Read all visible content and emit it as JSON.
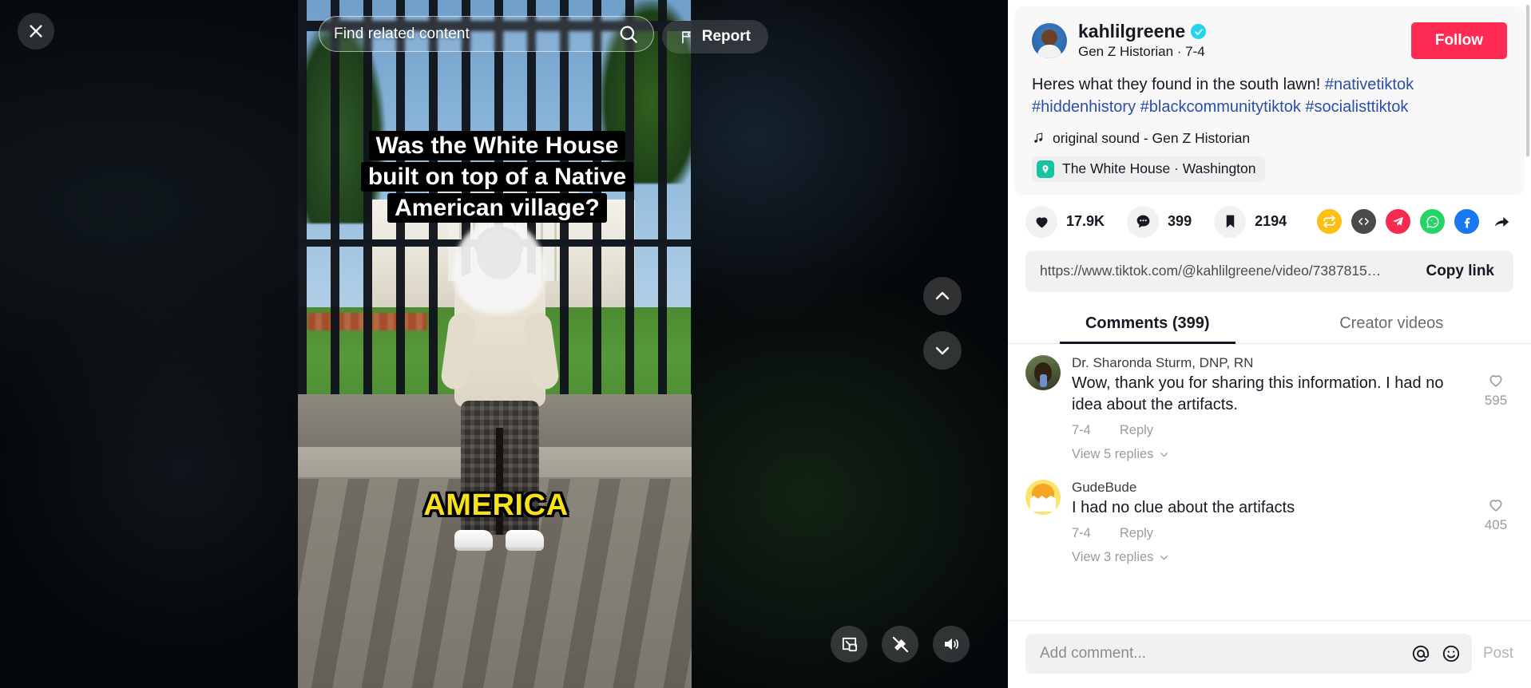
{
  "video": {
    "search_placeholder": "Find related content",
    "search_icon": "search-icon",
    "overlay_caption": "Was the White House built on top of a Native American village?",
    "overlay_word": "AMERICA",
    "close_icon": "close-icon",
    "report_label": "Report",
    "report_icon": "flag-icon",
    "nav_up_icon": "chevron-up-icon",
    "nav_down_icon": "chevron-down-icon",
    "controls": [
      {
        "name": "picture-in-picture-icon"
      },
      {
        "name": "clear-mode-icon"
      },
      {
        "name": "volume-on-icon"
      }
    ]
  },
  "author": {
    "username": "kahlilgreene",
    "verified": true,
    "verified_icon": "verified-badge-icon",
    "display_name": "Gen Z Historian",
    "date": "7-4",
    "subline": "Gen Z Historian · 7-4",
    "follow_label": "Follow",
    "follow_color": "#FE2C55",
    "avatar_name": "author-avatar"
  },
  "description": {
    "text": "Heres what they found in the south lawn! ",
    "hashtags": [
      "#nativetiktok",
      "#hiddenhistory",
      "#blackcommunitytiktok",
      "#socialisttiktok"
    ],
    "hashtag_color": "#2b4ea8"
  },
  "music": {
    "icon": "music-note-icon",
    "label": "original sound - Gen Z Historian"
  },
  "location": {
    "icon": "location-pin-icon",
    "icon_color": "#16C5A0",
    "label": "The White House · Washington"
  },
  "engagement": [
    {
      "name": "like-button",
      "icon": "heart-icon",
      "count": "17.9K"
    },
    {
      "name": "comment-button",
      "icon": "comment-icon",
      "count": "399"
    },
    {
      "name": "bookmark-button",
      "icon": "bookmark-icon",
      "count": "2194"
    }
  ],
  "share_icons": [
    {
      "name": "repost-icon",
      "color": "#FBBF15"
    },
    {
      "name": "embed-code-icon",
      "color": "#4A4A4A"
    },
    {
      "name": "telegram-icon",
      "color": "#F42A4F"
    },
    {
      "name": "whatsapp-icon",
      "color": "#25D366"
    },
    {
      "name": "facebook-icon",
      "color": "#1877F2"
    },
    {
      "name": "share-arrow-icon",
      "color": "#000000"
    }
  ],
  "link": {
    "url": "https://www.tiktok.com/@kahlilgreene/video/7387815…",
    "copy_label": "Copy link"
  },
  "tabs": [
    {
      "label": "Comments (399)",
      "active": true
    },
    {
      "label": "Creator videos",
      "active": false
    }
  ],
  "comments": [
    {
      "author": "Dr. Sharonda Sturm, DNP, RN",
      "text": "Wow, thank you for sharing this information. I had no idea about the artifacts.",
      "date": "7-4",
      "reply_label": "Reply",
      "likes": "595",
      "replies_label": "View 5 replies",
      "like_icon": "heart-outline-icon",
      "expand_icon": "chevron-down-icon"
    },
    {
      "author": "GudeBude",
      "text": "I had no clue about the artifacts",
      "date": "7-4",
      "reply_label": "Reply",
      "likes": "405",
      "replies_label": "View 3 replies",
      "like_icon": "heart-outline-icon",
      "expand_icon": "chevron-down-icon"
    }
  ],
  "comment_bar": {
    "placeholder": "Add comment...",
    "mention_icon": "at-mention-icon",
    "emoji_icon": "emoji-icon",
    "post_label": "Post"
  }
}
